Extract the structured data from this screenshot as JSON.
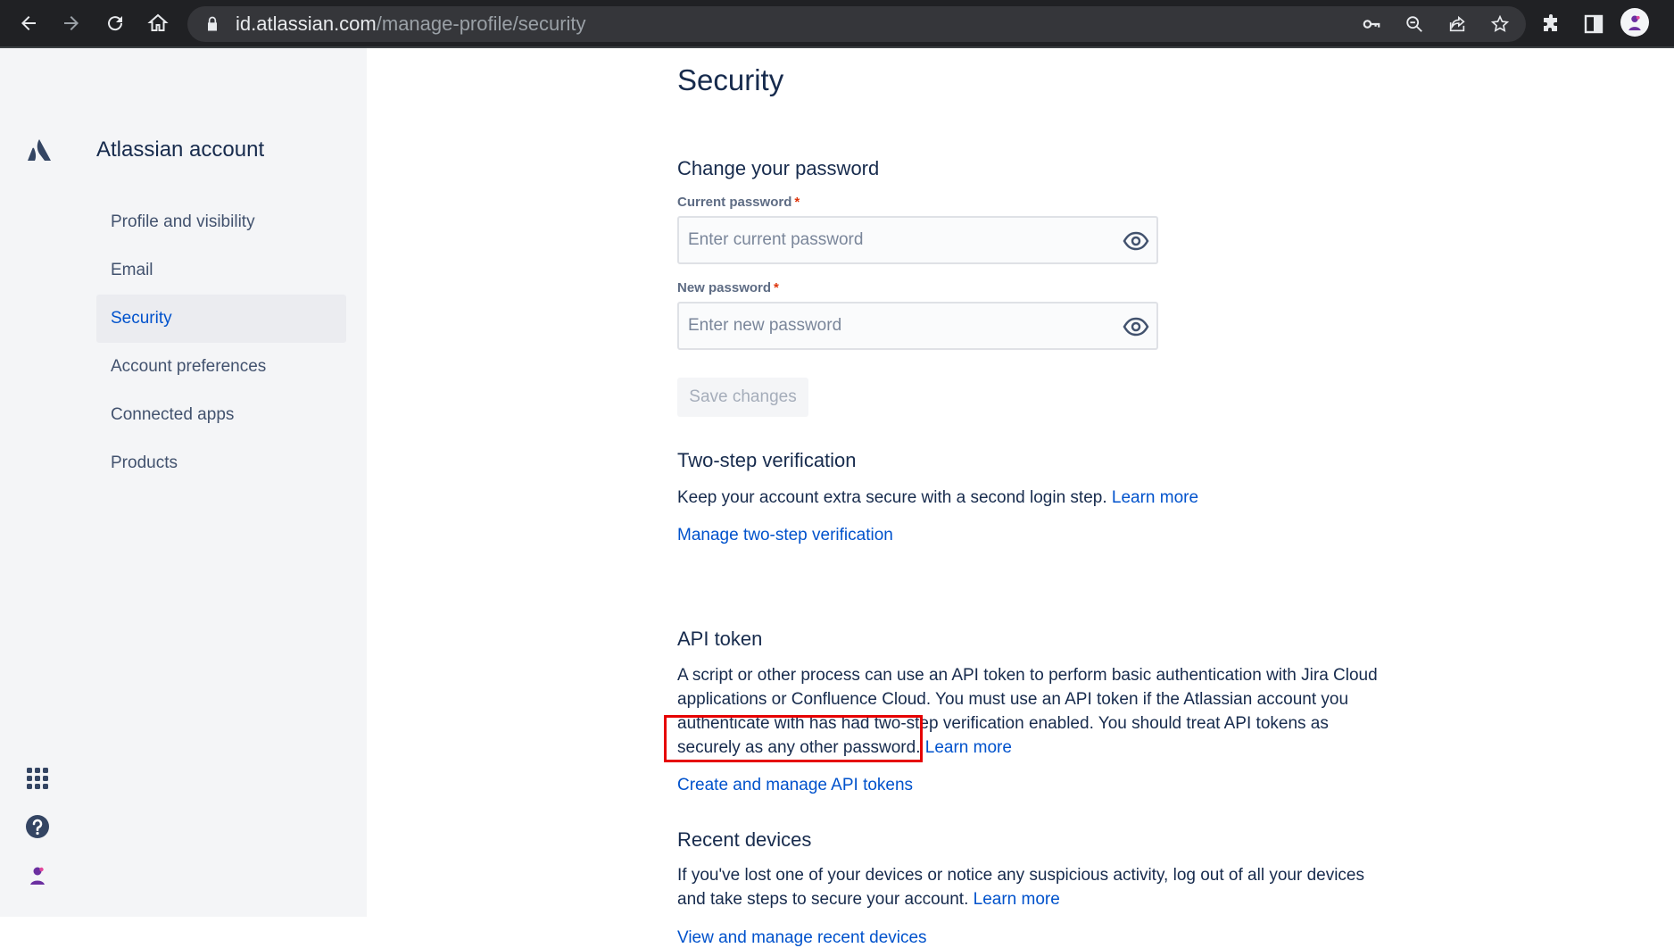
{
  "browser": {
    "url_host": "id.atlassian.com",
    "url_path": "/manage-profile/security"
  },
  "sidebar": {
    "app_title": "Atlassian account",
    "items": [
      {
        "label": "Profile and visibility"
      },
      {
        "label": "Email"
      },
      {
        "label": "Security",
        "active": true
      },
      {
        "label": "Account preferences"
      },
      {
        "label": "Connected apps"
      },
      {
        "label": "Products"
      }
    ]
  },
  "main": {
    "title": "Security",
    "password": {
      "heading": "Change your password",
      "current_label": "Current password",
      "current_placeholder": "Enter current password",
      "new_label": "New password",
      "new_placeholder": "Enter new password",
      "required_mark": "*",
      "save_label": "Save changes"
    },
    "two_step": {
      "heading": "Two-step verification",
      "text": "Keep your account extra secure with a second login step.",
      "learn_more": "Learn more",
      "manage_link": "Manage two-step verification"
    },
    "api_token": {
      "heading": "API token",
      "text": "A script or other process can use an API token to perform basic authentication with Jira Cloud applications or Confluence Cloud. You must use an API token if the Atlassian account you authenticate with has had two-step verification enabled. You should treat API tokens as securely as any other password.",
      "learn_more": "Learn more",
      "manage_link": "Create and manage API tokens"
    },
    "recent_devices": {
      "heading": "Recent devices",
      "text": "If you've lost one of your devices or notice any suspicious activity, log out of all your devices and take steps to secure your account.",
      "learn_more": "Learn more",
      "manage_link": "View and manage recent devices"
    }
  },
  "colors": {
    "accent_link": "#0052cc",
    "highlight_box": "#e60000",
    "sidebar_bg": "#f4f5f7"
  }
}
